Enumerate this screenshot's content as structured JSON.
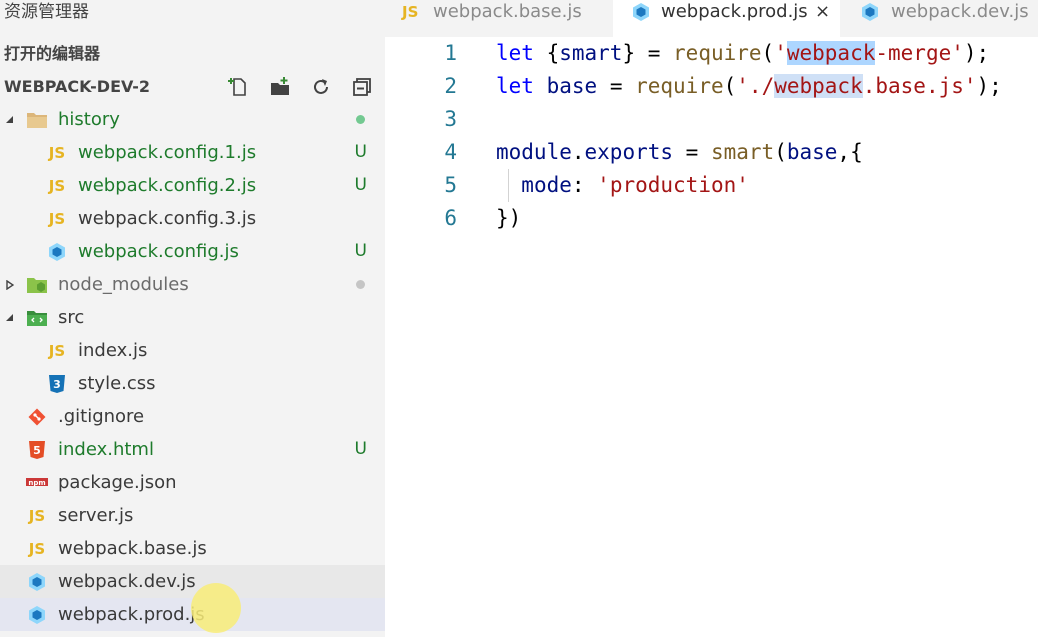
{
  "sidebar": {
    "title": "资源管理器",
    "open_editors_label": "打开的编辑器",
    "project_name": "WEBPACK-DEV-2",
    "actions": [
      {
        "name": "new-file-icon"
      },
      {
        "name": "new-folder-icon"
      },
      {
        "name": "refresh-icon"
      },
      {
        "name": "collapse-all-icon"
      }
    ],
    "tree": [
      {
        "label": "history",
        "icon": "folder-icon",
        "depth": 0,
        "expanded": true,
        "status": "dot",
        "color": "green"
      },
      {
        "label": "webpack.config.1.js",
        "icon": "js-icon",
        "depth": 1,
        "status": "U",
        "color": "green"
      },
      {
        "label": "webpack.config.2.js",
        "icon": "js-icon",
        "depth": 1,
        "status": "U",
        "color": "green"
      },
      {
        "label": "webpack.config.3.js",
        "icon": "js-icon",
        "depth": 1,
        "status": "",
        "color": "normal"
      },
      {
        "label": "webpack.config.js",
        "icon": "webpack-icon",
        "depth": 1,
        "status": "U",
        "color": "green"
      },
      {
        "label": "node_modules",
        "icon": "node-folder-icon",
        "depth": 0,
        "expanded": false,
        "status": "dot-gray",
        "color": "dim"
      },
      {
        "label": "src",
        "icon": "src-folder-icon",
        "depth": 0,
        "expanded": true,
        "status": "",
        "color": "normal"
      },
      {
        "label": "index.js",
        "icon": "js-icon",
        "depth": 1,
        "status": "",
        "color": "normal"
      },
      {
        "label": "style.css",
        "icon": "css-icon",
        "depth": 1,
        "status": "",
        "color": "normal"
      },
      {
        "label": ".gitignore",
        "icon": "git-icon",
        "depth": 0,
        "status": "",
        "color": "normal"
      },
      {
        "label": "index.html",
        "icon": "html-icon",
        "depth": 0,
        "status": "U",
        "color": "green"
      },
      {
        "label": "package.json",
        "icon": "npm-icon",
        "depth": 0,
        "status": "",
        "color": "normal"
      },
      {
        "label": "server.js",
        "icon": "js-icon",
        "depth": 0,
        "status": "",
        "color": "normal"
      },
      {
        "label": "webpack.base.js",
        "icon": "js-icon",
        "depth": 0,
        "status": "",
        "color": "normal"
      },
      {
        "label": "webpack.dev.js",
        "icon": "webpack-icon",
        "depth": 0,
        "status": "",
        "color": "normal",
        "state": "hover"
      },
      {
        "label": "webpack.prod.js",
        "icon": "webpack-icon",
        "depth": 0,
        "status": "",
        "color": "normal",
        "state": "selected"
      }
    ]
  },
  "tabs": [
    {
      "label": "webpack.base.js",
      "icon": "js-icon",
      "active": false
    },
    {
      "label": "webpack.prod.js",
      "icon": "webpack-icon",
      "active": true,
      "close": "×"
    },
    {
      "label": "webpack.dev.js",
      "icon": "webpack-icon",
      "active": false
    }
  ],
  "editor": {
    "line_numbers": [
      "1",
      "2",
      "3",
      "4",
      "5",
      "6"
    ],
    "lines": [
      [
        {
          "t": "let",
          "c": "kw"
        },
        {
          "t": " {",
          "c": ""
        },
        {
          "t": "smart",
          "c": "var"
        },
        {
          "t": "} = ",
          "c": ""
        },
        {
          "t": "require",
          "c": "fn"
        },
        {
          "t": "(",
          "c": ""
        },
        {
          "t": "'",
          "c": "str"
        },
        {
          "t": "webpack",
          "c": "str hl2"
        },
        {
          "t": "-merge'",
          "c": "str"
        },
        {
          "t": ");",
          "c": ""
        }
      ],
      [
        {
          "t": "let",
          "c": "kw"
        },
        {
          "t": " ",
          "c": ""
        },
        {
          "t": "base",
          "c": "var"
        },
        {
          "t": " = ",
          "c": ""
        },
        {
          "t": "require",
          "c": "fn"
        },
        {
          "t": "(",
          "c": ""
        },
        {
          "t": "'./",
          "c": "str"
        },
        {
          "t": "webpack",
          "c": "str hl"
        },
        {
          "t": ".base.js'",
          "c": "str"
        },
        {
          "t": ");",
          "c": ""
        }
      ],
      [],
      [
        {
          "t": "module",
          "c": "var"
        },
        {
          "t": ".",
          "c": ""
        },
        {
          "t": "exports",
          "c": "prop"
        },
        {
          "t": " = ",
          "c": ""
        },
        {
          "t": "smart",
          "c": "fn"
        },
        {
          "t": "(",
          "c": ""
        },
        {
          "t": "base",
          "c": "var"
        },
        {
          "t": ",{",
          "c": ""
        }
      ],
      [
        {
          "t": "  ",
          "c": ""
        },
        {
          "t": "mode",
          "c": "prop"
        },
        {
          "t": ": ",
          "c": ""
        },
        {
          "t": "'production'",
          "c": "str"
        }
      ],
      [
        {
          "t": "})",
          "c": ""
        }
      ]
    ]
  },
  "colors": {
    "git_untracked": "#1e7b2c",
    "keyword": "#0000ff",
    "string": "#a31515",
    "function": "#795e26",
    "variable": "#001080"
  }
}
